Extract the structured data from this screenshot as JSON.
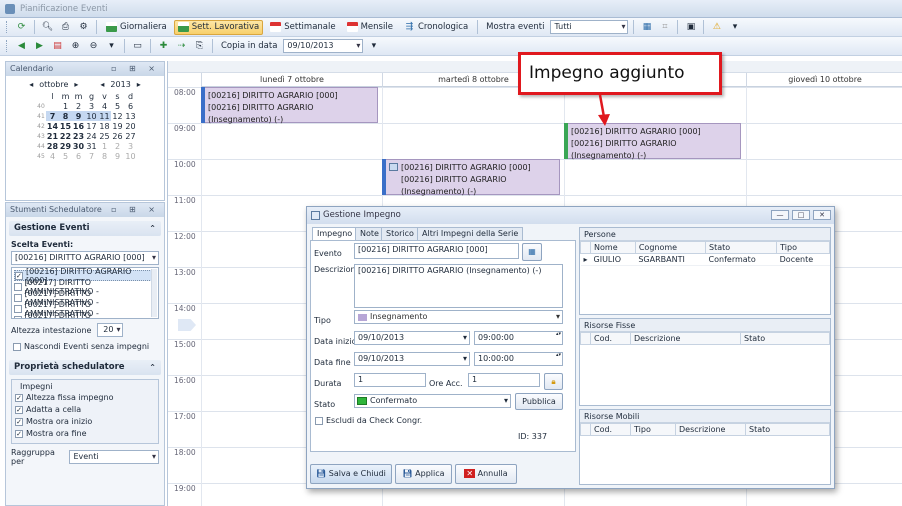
{
  "window": {
    "title": "Pianificazione Eventi"
  },
  "toolbar1": {
    "giornaliera": "Giornaliera",
    "sett_lav": "Sett. Lavorativa",
    "settimanale": "Settimanale",
    "mensile": "Mensile",
    "cronologica": "Cronologica",
    "mostra_eventi": "Mostra eventi",
    "mostra_value": "Tutti"
  },
  "toolbar2": {
    "copia_label": "Copia in data",
    "copia_value": "09/10/2013"
  },
  "calendar": {
    "title": "Calendario",
    "month": "ottobre",
    "year": "2013",
    "weekdays": [
      "l",
      "m",
      "m",
      "g",
      "v",
      "s",
      "d"
    ],
    "weeks": [
      [
        "40",
        "",
        "1",
        "2",
        "3",
        "4",
        "5",
        "6"
      ],
      [
        "41",
        "7",
        "8",
        "9",
        "10",
        "11",
        "12",
        "13"
      ],
      [
        "42",
        "14",
        "15",
        "16",
        "17",
        "18",
        "19",
        "20"
      ],
      [
        "43",
        "21",
        "22",
        "23",
        "24",
        "25",
        "26",
        "27"
      ],
      [
        "44",
        "28",
        "29",
        "30",
        "31",
        "1",
        "2",
        "3"
      ],
      [
        "45",
        "4",
        "5",
        "6",
        "7",
        "8",
        "9",
        "10"
      ]
    ]
  },
  "tools": {
    "title": "Stumenti Schedulatore",
    "gestione": "Gestione Eventi",
    "scelta": "Scelta Eventi:",
    "scelta_value": "[00216] DIRITTO AGRARIO [000]",
    "events": [
      "[00216] DIRITTO AGRARIO [000]",
      "[00217] DIRITTO AMMINISTRATIVO -",
      "[00217] DIRITTO AMMINISTRATIVO -",
      "[00217] DIRITTO AMMINISTRATIVO -",
      "[00217] DIRITTO AMMINISTRATIVO -"
    ],
    "altezza_label": "Altezza intestazione",
    "altezza_value": "20",
    "nascondi": "Nascondi Eventi senza impegni",
    "proprieta": "Proprietà schedulatore",
    "impegni": "Impegni",
    "opts": [
      "Altezza fissa impegno",
      "Adatta a cella",
      "Mostra ora inizio",
      "Mostra ora fine"
    ],
    "raggruppa_label": "Raggruppa per",
    "raggruppa_value": "Eventi"
  },
  "scheduler": {
    "days": [
      "lunedì 7 ottobre",
      "martedì 8 ottobre",
      "",
      "giovedì 10 ottobre"
    ],
    "hours": [
      "08:00",
      "09:00",
      "10:00",
      "11:00",
      "12:00",
      "13:00",
      "14:00",
      "15:00",
      "16:00",
      "17:00",
      "18:00",
      "19:00"
    ],
    "appt_title": "[00216] DIRITTO AGRARIO [000]",
    "appt_desc": "[00216] DIRITTO AGRARIO (Insegnamento) (-)",
    "bar_blue": "#3a6fc8",
    "bar_green": "#3aa655"
  },
  "callout": {
    "text": "Impegno aggiunto"
  },
  "dialog": {
    "title": "Gestione Impegno",
    "tabs": [
      "Impegno",
      "Note",
      "Storico",
      "Altri Impegni della Serie"
    ],
    "evento_label": "Evento",
    "evento_value": "[00216] DIRITTO AGRARIO [000]",
    "descrizione_label": "Descrizione",
    "descrizione_value": "[00216] DIRITTO AGRARIO (Insegnamento) (-)",
    "tipo_label": "Tipo",
    "tipo_value": "Insegnamento",
    "data_inizio_label": "Data inizio",
    "data_inizio": "09/10/2013",
    "ora_inizio": "09:00:00",
    "data_fine_label": "Data fine",
    "data_fine": "09/10/2013",
    "ora_fine": "10:00:00",
    "durata_label": "Durata",
    "durata_value": "1",
    "ore_acc_label": "Ore Acc.",
    "ore_acc_value": "1",
    "stato_label": "Stato",
    "stato_value": "Confermato",
    "pubblica": "Pubblica",
    "escludi": "Escludi da Check Congr.",
    "id_label": "ID: 337",
    "salva": "Salva e Chiudi",
    "applica": "Applica",
    "annulla": "Annulla",
    "persone": {
      "title": "Persone",
      "cols": [
        "Nome",
        "Cognome",
        "Stato",
        "Tipo"
      ],
      "row": [
        "GIULIO",
        "SGARBANTI",
        "Confermato",
        "Docente"
      ]
    },
    "fisse": {
      "title": "Risorse Fisse",
      "cols": [
        "Cod.",
        "Descrizione",
        "Stato"
      ]
    },
    "mobili": {
      "title": "Risorse Mobili",
      "cols": [
        "Cod.",
        "Tipo",
        "Descrizione",
        "Stato"
      ]
    }
  }
}
